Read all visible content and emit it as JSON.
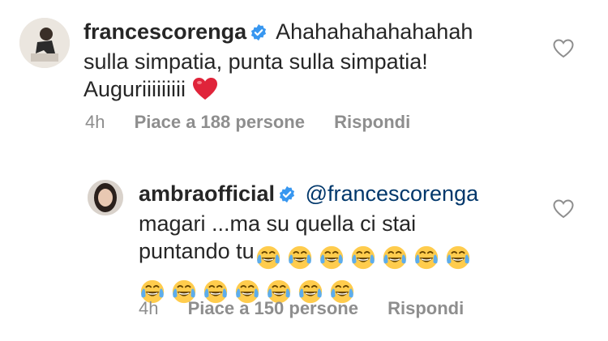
{
  "comments": [
    {
      "username": "francescorenga",
      "text_lines": [
        "Ahahahahahahahah",
        "sulla simpatia, punta sulla simpatia!",
        "Auguriiiiiiiii"
      ],
      "trailing_emoji": "red-heart",
      "time": "4h",
      "likes": "Piace a 188 persone",
      "reply": "Rispondi"
    },
    {
      "username": "ambraofficial",
      "mention": "@francescorenga",
      "text_lines": [
        "magari ...ma su quella ci stai",
        "puntando tu"
      ],
      "emoji": "face-with-tears-of-joy",
      "emoji_count_line1": 7,
      "emoji_count_line2": 7,
      "time": "4h",
      "likes": "Piace a 150 persone",
      "reply": "Rispondi"
    }
  ],
  "colors": {
    "verified": "#3897f0",
    "mention": "#00376b",
    "meta": "#8e8e8e",
    "heart": "#ed4956"
  }
}
